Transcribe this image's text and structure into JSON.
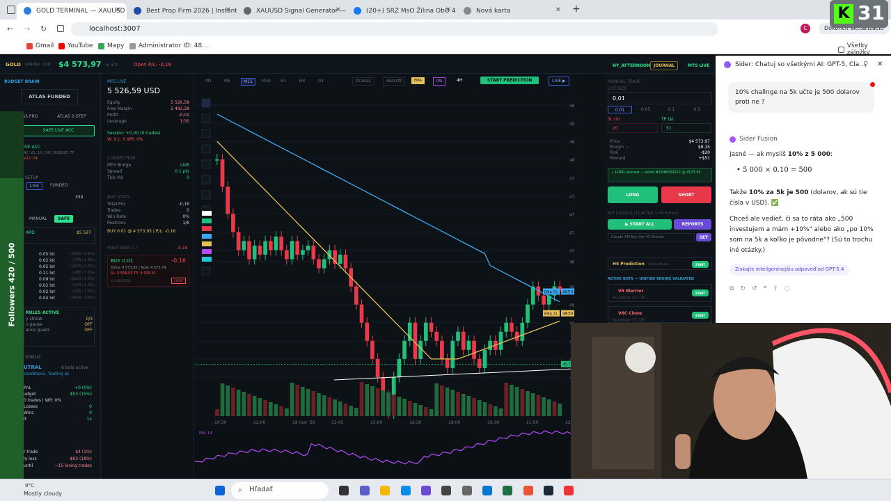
{
  "tabs": [
    {
      "label": "GOLD TERMINAL — XAUUSD",
      "color": "#2b7fd6"
    },
    {
      "label": "Best Prop Firm 2026 | Instant Fu",
      "color": "#1f4ea8"
    },
    {
      "label": "XAUUSD Signal Generator — Tr",
      "color": "#555"
    },
    {
      "label": "(20+) SRZ MsO Žilina ObO 4 Ro",
      "color": "#1877f2"
    },
    {
      "label": "Nová karta",
      "color": "#777"
    }
  ],
  "new_tab": "+",
  "address": "localhost:3007",
  "update_btn": "Dokončiť aktualizáciu",
  "profile": "C",
  "badge_num": "31",
  "bookmarks": [
    "Gmail",
    "YouTube",
    "Mapy",
    "Administrator ID: 48..."
  ],
  "all_bookmarks": "Všetky záložky",
  "app": {
    "symbol": "GOLD",
    "symbol_sub": "XAUUSD · USD",
    "price": "$4 573,97",
    "price_sub": "(r: 4.3)",
    "open_pl": "Open P/L: -0,16",
    "timeframes": [
      "M1",
      "M5",
      "M15",
      "M30",
      "H1",
      "H4",
      "D1"
    ],
    "tools": [
      "SIGNALS",
      "ANALYZE",
      "EMA",
      "RSI"
    ],
    "tf_select": "4H",
    "start_pred": "START PREDICTION",
    "live_btn": "LIVE ▶",
    "pill_session": "NY_AFTERNOON",
    "pill_journal": "JOURNAL",
    "pill_mts": "MTS LIVE"
  },
  "left": {
    "budget": "BUDGET BRAIN",
    "account": "ATLAS FUNDED",
    "tabs": [
      "AS PRO",
      "ATLAS 2-STEP"
    ],
    "safe_live": "SAFE LIVE ACC",
    "live_acc": "IVE ACC",
    "acc_lines": [
      "AC, V1, 1X, CXC, RUDOLF, TF",
      "V22, D4"
    ],
    "setup": "SETUP",
    "live": "LIVE",
    "funded": "FUNDED",
    "num": "350",
    "manual": "MANUAL",
    "safe": "SAFE",
    "card": "ARD",
    "card_val": "$5 527",
    "lots": [
      {
        "a": "0.05 lot",
        "b": "(-$125 / 2.3%)"
      },
      {
        "a": "0.02 lot",
        "b": "(-$70 / 1.3%)"
      },
      {
        "a": "0.05 lot",
        "b": "(-$125 / 2.3%)"
      },
      {
        "a": "0.11 lot",
        "b": "(-$80 / 1.5%)"
      },
      {
        "a": "0.09 lot",
        "b": "(-$102 / 2.0%)"
      },
      {
        "a": "0.02 lot",
        "b": "(-$70 / 1.3%)"
      },
      {
        "a": "0.02 lot",
        "b": "(-$70 / 1.3%)"
      },
      {
        "a": "0.04 lot",
        "b": "(-$109 / 2.0%)"
      }
    ],
    "rules": "RULES ACTIVE",
    "rules_rows": [
      [
        "y streak",
        "0/3"
      ],
      [
        "n pause",
        "OFF"
      ],
      [
        "ance guard",
        "OFF"
      ]
    ],
    "status": "STATUS",
    "neutral": "UTRAL",
    "bots_active": "8 bots active",
    "conditions": "conditions. Trading as",
    "stat_rows": [
      [
        "PnL",
        "+0 (0%)"
      ],
      [
        "udget",
        "$53 (15%)"
      ],
      [
        "0 trades | WR: 0%",
        ""
      ],
      [
        "Losses",
        "0"
      ],
      [
        "Wins",
        "0"
      ],
      [
        "lt",
        "1x"
      ]
    ],
    "risk_rows": [
      [
        "r trade",
        "$4 (1%)"
      ],
      [
        "ly loss",
        "-$93 (18%)"
      ],
      [
        "until",
        "~15 losing trades"
      ]
    ],
    "weather": "9°C",
    "weather2": "Mostly cloudy"
  },
  "mid": {
    "mts_live": "MTS LIVE",
    "balance": "5 526,59 USD",
    "acct": [
      [
        "Equity",
        "5 526,58"
      ],
      [
        "Free Margin",
        "5 492,28"
      ],
      [
        "Profit",
        "-0,01"
      ],
      [
        "Leverage",
        "1:30"
      ]
    ],
    "session": "Session: +0,00 (0 trades)",
    "wl": "W: 0  L: 0  WR: 0%",
    "connection": "CONNECTION",
    "conn": [
      [
        "MTS Bridge",
        "LIVE"
      ],
      [
        "Spread",
        "0.1 pts"
      ],
      [
        "Tick Vol",
        "0"
      ]
    ],
    "bot_stats": "BOT STATS",
    "stats": [
      [
        "Total PnL",
        "-0,16"
      ],
      [
        "Trades",
        "0"
      ],
      [
        "Win Rate",
        "0%"
      ],
      [
        "Positions",
        "1/6"
      ]
    ],
    "buy_line": "BUY 0.01 @ 4 573,95 | P/L: -0,16",
    "positions": "POSITIONS (1)",
    "pos_pl": "-0,16",
    "pos_title": "BUY 0.01",
    "pos_val": "-0,16",
    "pos_entry": "Entry: 4 573,95 | Now: 4 573,79",
    "pos_sl": "SL: 4 556,53  TP: 4 625,53",
    "pos_id": "#1546030012",
    "close": "CLOSE"
  },
  "chart_data": {
    "type": "candlestick",
    "xlabels": [
      "10:30",
      "12:00",
      "19 mar '26",
      "13:45",
      "15:00",
      "16:30",
      "18:00",
      "19:30",
      "21:00",
      "22:30"
    ],
    "ylabels": [
      "4860.00",
      "4840.00",
      "4820.00",
      "4800.00",
      "4780.00",
      "4760.00",
      "4740.00",
      "4720.00",
      "4700.00",
      "4687.72",
      "4660.00",
      "4640.00",
      "4620.00",
      "4600.00",
      "4580.00",
      "4560.00"
    ],
    "ema50_label": "EMA 50",
    "ema50_val": "4653.46",
    "ema21_label": "EMA 21",
    "ema21_val": "4630.24",
    "price_tag": "4654.50",
    "cur_price": "4573.94",
    "rsi_label": "RSI 14",
    "candles": [
      4800,
      4770,
      4740,
      4720,
      4700,
      4710,
      4690,
      4705,
      4695,
      4710,
      4700,
      4715,
      4700,
      4690,
      4710,
      4695,
      4700,
      4705,
      4690,
      4680,
      4690,
      4700,
      4685,
      4695,
      4680,
      4660,
      4640,
      4620,
      4600,
      4580,
      4560,
      4540,
      4520,
      4560,
      4580,
      4600,
      4620,
      4580,
      4600,
      4620,
      4610,
      4600,
      4580,
      4570,
      4600,
      4610,
      4590,
      4600,
      4580,
      4570,
      4590,
      4600,
      4590,
      4610,
      4620,
      4610,
      4600,
      4620,
      4640,
      4660,
      4650,
      4640,
      4650,
      4660,
      4655
    ]
  },
  "right": {
    "manual_trade": "MANUAL TRADE",
    "lot_size": "LOT SIZE",
    "lot_val": "0,01",
    "lot_opts": [
      "0.01",
      "0.05",
      "0.1",
      "0.5"
    ],
    "sl": "SL ($)",
    "tp": "TP ($)",
    "sl_val": "20",
    "tp_val": "51",
    "info": [
      [
        "Price",
        "$4 573,97"
      ],
      [
        "Margin ~",
        "$9,15"
      ],
      [
        "Risk",
        "-$20"
      ],
      [
        "Reward",
        "+$51"
      ]
    ],
    "opened": "✓ LONG opened — ticket #1546030012 @ 4573.95",
    "long": "LONG",
    "short": "SHORT",
    "bot_control": "BOT CONTROL (12 ACTIVE + H4 Python)",
    "start_all": "▶ START ALL",
    "reports": "REPORTS",
    "claude": "Claude API Key (for V5 Oracle)",
    "set": "SET",
    "h4": "H4 Prediction",
    "h4_sub": "Python ML bot",
    "start": "START",
    "active_bots": "ACTIVE BOTS — UNIFIED ENGINE VALIDATED",
    "v6": "V6 Warrior",
    "v6_sub": "No prediction (TF: 1.00)",
    "v6c": "V6C Clone",
    "v6c_sub": "No prediction (TF: 1.00)"
  },
  "sider": {
    "title": "Sider: Chatuj so všetkými AI: GPT-5, Cla...",
    "user_msg": "10% challnge na 5k učte je 500 dolarov proti ne ?",
    "bot": "Sider Fusion",
    "p1a": "Jasné — ak myslíš ",
    "p1b": "10% z 5 000",
    ":": ":",
    "formula": "5 000 × 0.10 = 500",
    "p2a": "Takže ",
    "p2b": "10% za 5k je 500",
    " p2c": " (dolarov, ak sú tie čísla v USD). ✅",
    "p3": "Chceš ale vedieť, či sa to ráta ako „500 investujem a mám +10%\" alebo ako „po 10% som na 5k a koľko je pôvodne\"? (Sú to trochu iné otázky.)",
    "smarter": "Získajte inteligentnejšiu odpoveď od GPT-5.4"
  },
  "followers": "Followers 420 / 500",
  "taskbar": {
    "search": "Hľadať"
  }
}
